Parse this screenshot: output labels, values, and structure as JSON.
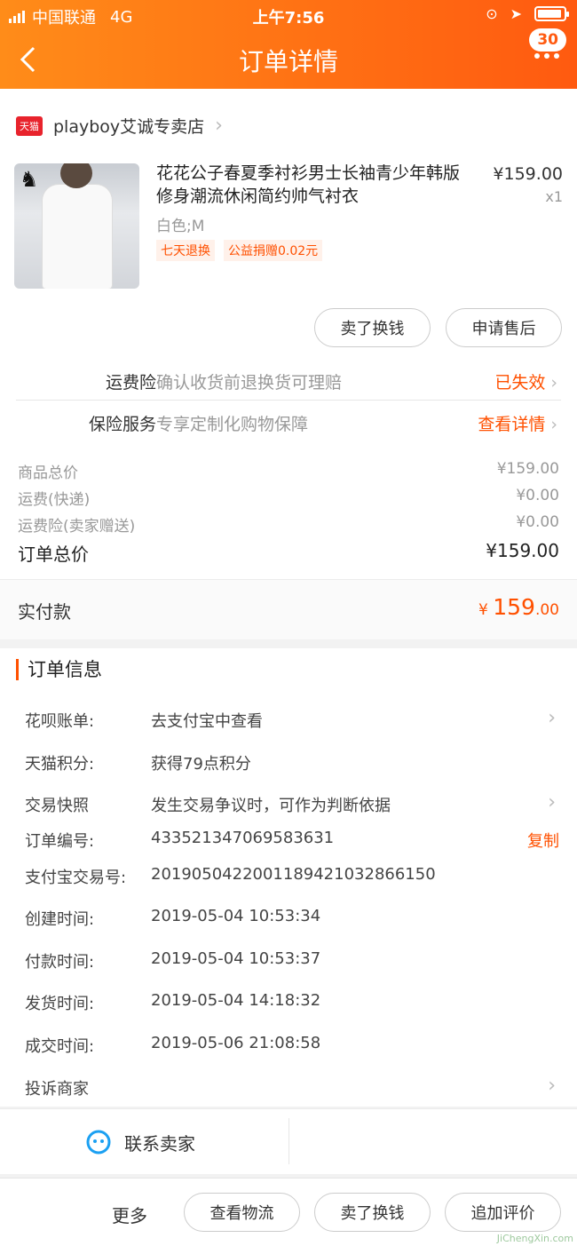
{
  "status_bar": {
    "carrier": "中国联通",
    "network": "4G",
    "time": "上午7:56"
  },
  "nav": {
    "title": "订单详情",
    "badge": "30"
  },
  "store": {
    "badge": "天猫",
    "name": "playboy艾诚专卖店"
  },
  "product": {
    "name": "花花公子春夏季衬衫男士长袖青少年韩版修身潮流休闲简约帅气衬衣",
    "price": "¥159.00",
    "qty": "x1",
    "sku": "白色;M",
    "tags": [
      "七天退换",
      "公益捐赠0.02元"
    ]
  },
  "item_actions": {
    "sell_label": "卖了换钱",
    "after_sale_label": "申请售后"
  },
  "insurance": [
    {
      "label": "运费险",
      "desc": "确认收货前退换货可理赔",
      "value": "已失效"
    },
    {
      "label": "保险服务",
      "desc": "专享定制化购物保障",
      "value": "查看详情"
    }
  ],
  "summary": [
    {
      "label": "商品总价",
      "value": "¥159.00"
    },
    {
      "label": "运费(快递)",
      "value": "¥0.00"
    },
    {
      "label": "运费险(卖家赠送)",
      "value": "¥0.00"
    }
  ],
  "order_total": {
    "label": "订单总价",
    "value": "¥159.00"
  },
  "paid": {
    "label": "实付款",
    "currency": "¥",
    "integer": "159",
    "decimal": ".00"
  },
  "order_info": {
    "title": "订单信息",
    "rows": [
      {
        "key": "花呗账单:",
        "value": "去支付宝中查看"
      },
      {
        "key": "天猫积分:",
        "value": "获得79点积分"
      },
      {
        "key": "交易快照",
        "value": "发生交易争议时，可作为判断依据"
      },
      {
        "key": "订单编号:",
        "value": "433521347069583631",
        "action": "复制"
      },
      {
        "key": "支付宝交易号:",
        "value": "2019050422001189421032866150"
      },
      {
        "key": "创建时间:",
        "value": "2019-05-04 10:53:34"
      },
      {
        "key": "付款时间:",
        "value": "2019-05-04 10:53:37"
      },
      {
        "key": "发货时间:",
        "value": "2019-05-04 14:18:32"
      },
      {
        "key": "成交时间:",
        "value": "2019-05-06 21:08:58"
      },
      {
        "key": "投诉商家",
        "value": ""
      }
    ]
  },
  "contact": {
    "label": "联系卖家"
  },
  "bottom_bar": {
    "more": "更多",
    "logistics": "查看物流",
    "sell": "卖了换钱",
    "review": "追加评价"
  },
  "watermark": "JiChengXin.com",
  "colors": {
    "accent": "#ff5000",
    "header_start": "#ff8c19",
    "header_end": "#ff5a10"
  }
}
